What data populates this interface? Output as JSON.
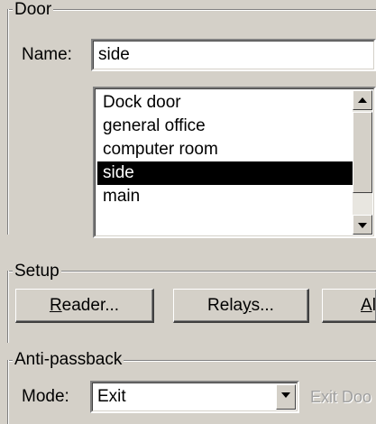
{
  "door": {
    "group_label": "Door",
    "name_label": "Name:",
    "name_value": "side",
    "list_items": [
      {
        "label": "Dock door",
        "selected": false
      },
      {
        "label": "general office",
        "selected": false
      },
      {
        "label": "computer room",
        "selected": false
      },
      {
        "label": "side",
        "selected": true
      },
      {
        "label": "main",
        "selected": false
      }
    ]
  },
  "setup": {
    "group_label": "Setup",
    "reader_button": "Reader...",
    "relays_button": "Relays...",
    "alarm_button_partial": "Alar"
  },
  "antipassback": {
    "group_label": "Anti-passback",
    "mode_label": "Mode:",
    "mode_value": "Exit",
    "exit_door_partial": "Exit Doo"
  },
  "icons": {
    "scroll_up": "scroll-up-arrow-icon",
    "scroll_down": "scroll-down-arrow-icon",
    "combo_dropdown": "chevron-down-icon"
  }
}
